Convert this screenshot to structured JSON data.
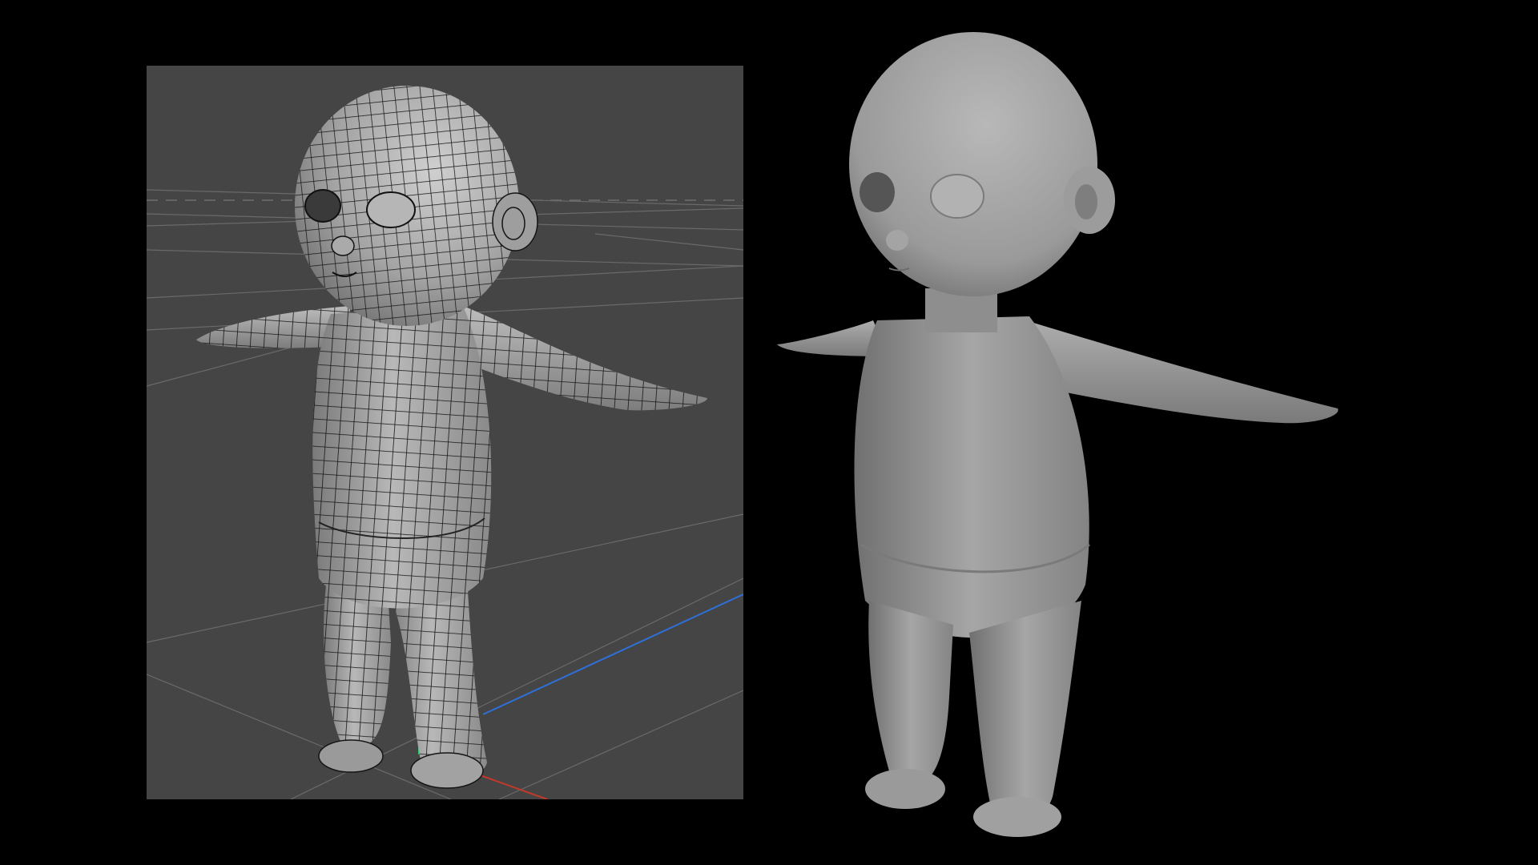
{
  "scene": {
    "background_color": "#000000",
    "panels": [
      {
        "id": "wireframe-viewport",
        "description_icon": "wireframe-mesh",
        "background_color": "#454545"
      },
      {
        "id": "smooth-render",
        "description_icon": "smooth-shaded",
        "background_color": "#000000"
      }
    ],
    "colors": {
      "mesh_surface": "#a8a8a8",
      "wire": "#111111",
      "grid": "#6a6a6a",
      "axis_x": "#c0392b",
      "axis_y": "#2ecc71",
      "axis_z": "#2f6fd6",
      "render_surface": "#9e9e9e"
    }
  }
}
